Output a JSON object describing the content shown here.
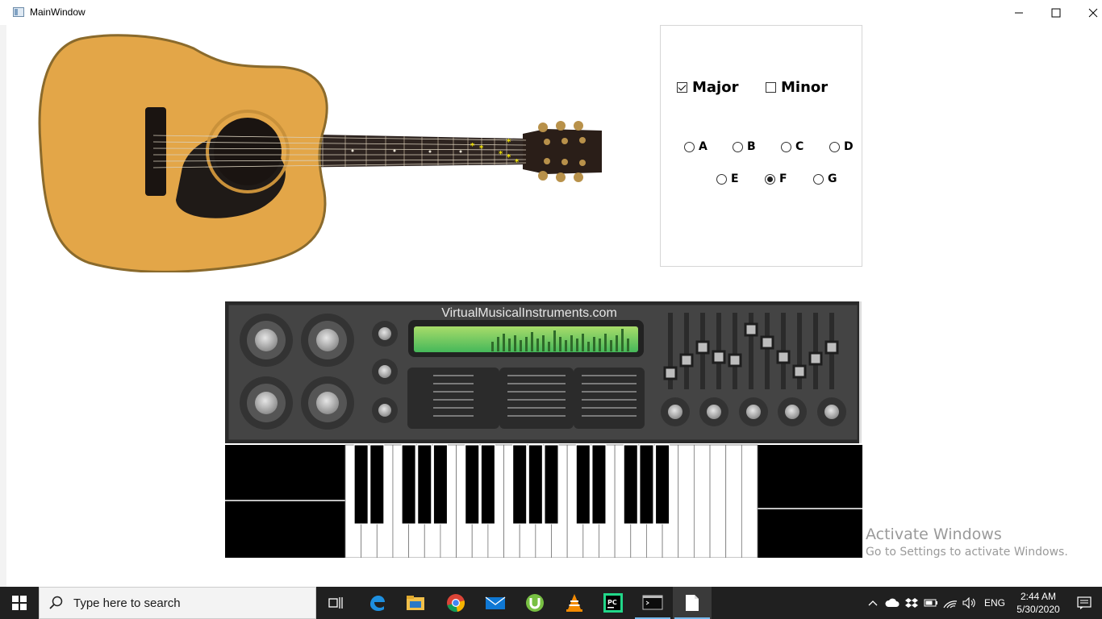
{
  "window": {
    "title": "MainWindow"
  },
  "options": {
    "major_label": "Major",
    "major_checked": true,
    "minor_label": "Minor",
    "minor_checked": false,
    "keys": [
      "A",
      "B",
      "C",
      "D",
      "E",
      "F",
      "G"
    ],
    "selected_key": "F"
  },
  "synth": {
    "brand": "VirtualMusicalInstruments.com"
  },
  "watermark": {
    "line1": "Activate Windows",
    "line2": "Go to Settings to activate Windows."
  },
  "taskbar": {
    "search_placeholder": "Type here to search",
    "language": "ENG",
    "time": "2:44 AM",
    "date": "5/30/2020",
    "apps": [
      "task-view",
      "edge",
      "file-explorer",
      "chrome",
      "mail",
      "utorrent",
      "vlc",
      "pycharm",
      "terminal",
      "file"
    ]
  },
  "colors": {
    "accent": "#76b9ed",
    "taskbar": "#202020",
    "guitar_body": "#e5a53f",
    "synth_body": "#3a3a3a",
    "display_green": "#6fc96a"
  }
}
